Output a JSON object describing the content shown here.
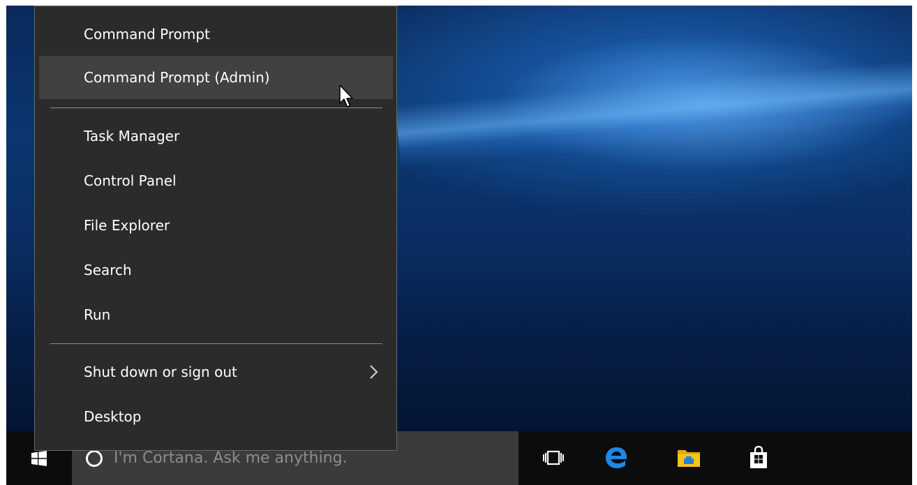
{
  "menu": {
    "items": [
      {
        "label": "Command Prompt",
        "hovered": false
      },
      {
        "label": "Command Prompt (Admin)",
        "hovered": true
      },
      {
        "label": "Task Manager",
        "hovered": false
      },
      {
        "label": "Control Panel",
        "hovered": false
      },
      {
        "label": "File Explorer",
        "hovered": false
      },
      {
        "label": "Search",
        "hovered": false
      },
      {
        "label": "Run",
        "hovered": false
      },
      {
        "label": "Shut down or sign out",
        "hovered": false,
        "submenu": true
      },
      {
        "label": "Desktop",
        "hovered": false
      }
    ]
  },
  "taskbar": {
    "search_placeholder": "I'm Cortana. Ask me anything.",
    "icons": [
      "windows-logo-icon",
      "cortana-icon",
      "task-view-icon",
      "edge-icon",
      "file-explorer-icon",
      "store-icon"
    ]
  },
  "colors": {
    "menu_bg": "#2b2b2b",
    "menu_hover": "#414141",
    "taskbar_bg": "#0c0c0d",
    "search_bg": "#3b3b3c",
    "edge_blue": "#1e88e5",
    "folder_yellow": "#f5c518"
  }
}
